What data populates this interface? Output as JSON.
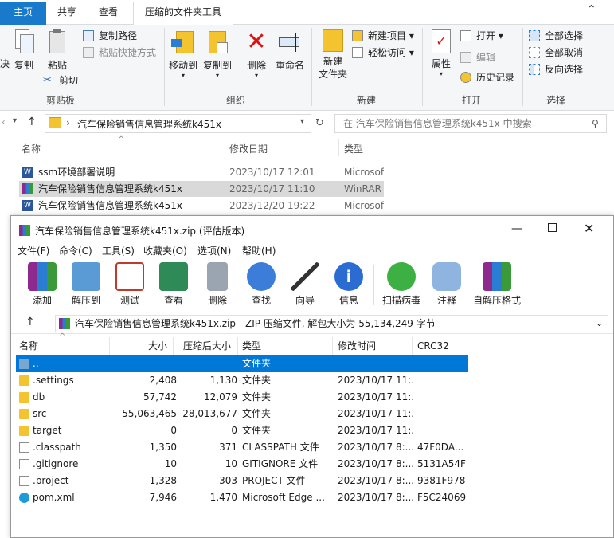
{
  "explorer": {
    "tabs": {
      "home": "主页",
      "share": "共享",
      "view": "查看",
      "ctx": "压缩的文件夹工具"
    },
    "ribbon": {
      "clipboard": {
        "label": "剪贴板",
        "copy": "复制",
        "paste": "粘贴",
        "copy_path": "复制路径",
        "paste_shortcut": "粘贴快捷方式",
        "cut": "剪切",
        "left_cut": "决"
      },
      "organize": {
        "label": "组织",
        "move_to": "移动到",
        "copy_to": "复制到",
        "delete": "删除",
        "rename": "重命名"
      },
      "new": {
        "label": "新建",
        "new_folder": "新建\n文件夹",
        "new_item": "新建项目",
        "easy_access": "轻松访问"
      },
      "open": {
        "label": "打开",
        "properties": "属性",
        "open": "打开",
        "edit": "编辑",
        "history": "历史记录"
      },
      "select": {
        "label": "选择",
        "select_all": "全部选择",
        "select_none": "全部取消",
        "invert": "反向选择"
      }
    },
    "address": {
      "path": "汽车保险销售信息管理系统k451x",
      "search_placeholder": "在 汽车保险销售信息管理系统k451x 中搜索"
    },
    "columns": {
      "name": "名称",
      "modified": "修改日期",
      "type": "类型"
    },
    "files": [
      {
        "name": "ssm环境部署说明",
        "modified": "2023/10/17 12:01",
        "type": "Microsoft"
      },
      {
        "name": "汽车保险销售信息管理系统k451x",
        "modified": "2023/10/17 11:10",
        "type": "WinRAR"
      },
      {
        "name": "汽车保险销售信息管理系统k451x",
        "modified": "2023/12/20 19:22",
        "type": "Microsoft"
      }
    ]
  },
  "winrar": {
    "title": "汽车保险销售信息管理系统k451x.zip (评估版本)",
    "menu": [
      "文件(F)",
      "命令(C)",
      "工具(S)",
      "收藏夹(O)",
      "选项(N)",
      "帮助(H)"
    ],
    "toolbar": [
      "添加",
      "解压到",
      "测试",
      "查看",
      "删除",
      "查找",
      "向导",
      "信息",
      "扫描病毒",
      "注释",
      "自解压格式"
    ],
    "path": "汽车保险销售信息管理系统k451x.zip - ZIP 压缩文件, 解包大小为 55,134,249 字节",
    "columns": {
      "name": "名称",
      "size": "大小",
      "packed": "压缩后大小",
      "type": "类型",
      "modified": "修改时间",
      "crc": "CRC32"
    },
    "rows": [
      {
        "name": "..",
        "size": "",
        "packed": "",
        "type": "文件夹",
        "modified": "",
        "crc": ""
      },
      {
        "name": ".settings",
        "size": "2,408",
        "packed": "1,130",
        "type": "文件夹",
        "modified": "2023/10/17 11:...",
        "crc": ""
      },
      {
        "name": "db",
        "size": "57,742",
        "packed": "12,079",
        "type": "文件夹",
        "modified": "2023/10/17 11:...",
        "crc": ""
      },
      {
        "name": "src",
        "size": "55,063,465",
        "packed": "28,013,677",
        "type": "文件夹",
        "modified": "2023/10/17 11:...",
        "crc": ""
      },
      {
        "name": "target",
        "size": "0",
        "packed": "0",
        "type": "文件夹",
        "modified": "2023/10/17 11:...",
        "crc": ""
      },
      {
        "name": ".classpath",
        "size": "1,350",
        "packed": "371",
        "type": "CLASSPATH 文件",
        "modified": "2023/10/17 8:...",
        "crc": "47F0DA..."
      },
      {
        "name": ".gitignore",
        "size": "10",
        "packed": "10",
        "type": "GITIGNORE 文件",
        "modified": "2023/10/17 8:...",
        "crc": "5131A54F"
      },
      {
        "name": ".project",
        "size": "1,328",
        "packed": "303",
        "type": "PROJECT 文件",
        "modified": "2023/10/17 8:...",
        "crc": "9381F978"
      },
      {
        "name": "pom.xml",
        "size": "7,946",
        "packed": "1,470",
        "type": "Microsoft Edge ...",
        "modified": "2023/10/17 8:...",
        "crc": "F5C24069"
      }
    ]
  }
}
